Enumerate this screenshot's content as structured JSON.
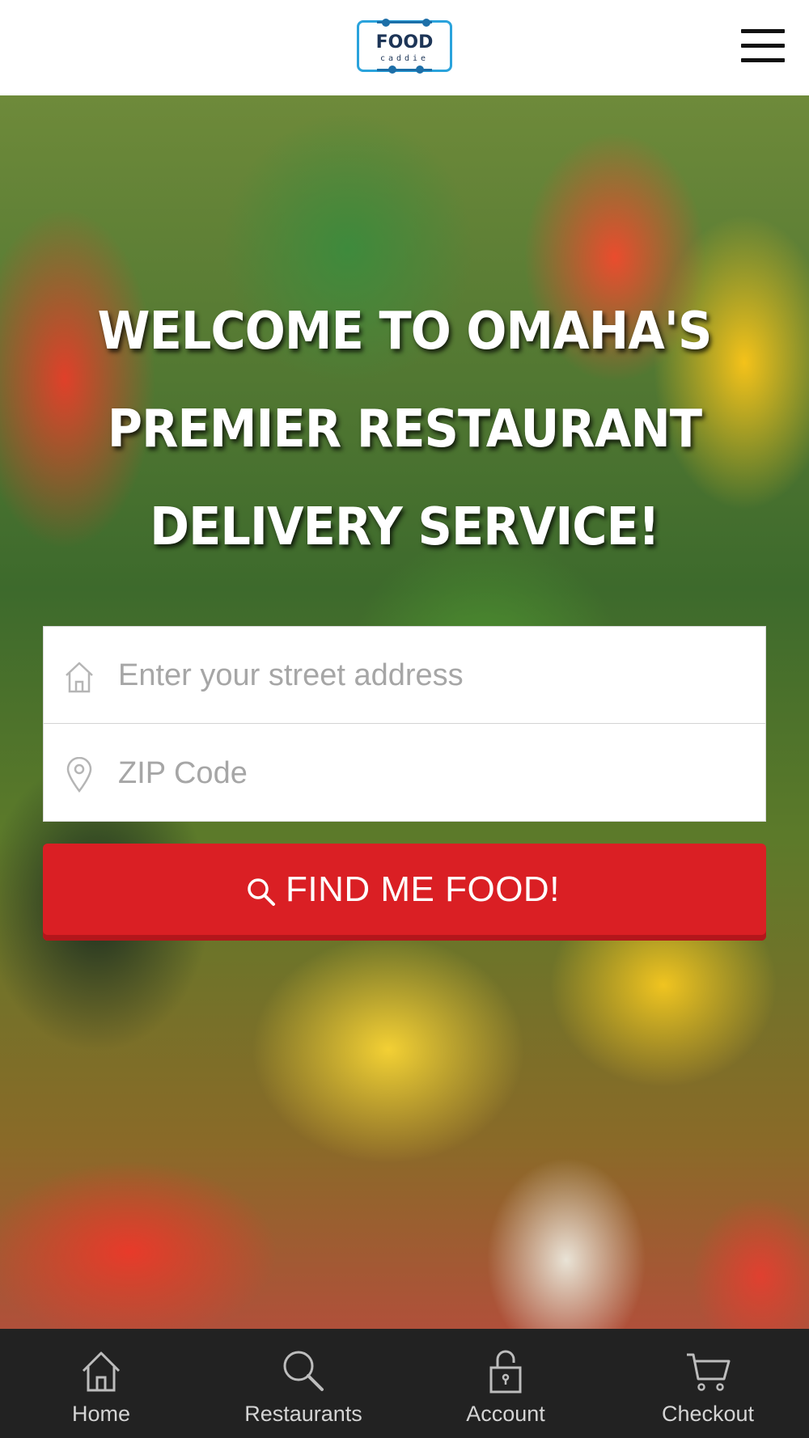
{
  "header": {
    "logo": {
      "wordmark": "FOOD",
      "subtitle": "caddie",
      "icon": "food-caddie-logo"
    },
    "menu_icon": "hamburger-menu-icon"
  },
  "hero": {
    "headline": [
      "WELCOME TO OMAHA'S",
      "PREMIER RESTAURANT",
      "DELIVERY SERVICE!"
    ],
    "address_field": {
      "placeholder": "Enter your street address",
      "value": "",
      "icon": "home-icon"
    },
    "zip_field": {
      "placeholder": "ZIP Code",
      "value": "",
      "icon": "location-pin-icon"
    },
    "find_button": {
      "label": "FIND ME FOOD!",
      "icon": "search-icon"
    }
  },
  "bottom_nav": {
    "items": [
      {
        "label": "Home",
        "icon": "home-icon"
      },
      {
        "label": "Restaurants",
        "icon": "search-icon"
      },
      {
        "label": "Account",
        "icon": "unlocked-padlock-icon"
      },
      {
        "label": "Checkout",
        "icon": "shopping-cart-icon"
      }
    ]
  },
  "colors": {
    "accent_red": "#da1f24",
    "logo_blue": "#2aa3dc",
    "nav_background": "#222222",
    "nav_text": "#d4d4d4"
  }
}
